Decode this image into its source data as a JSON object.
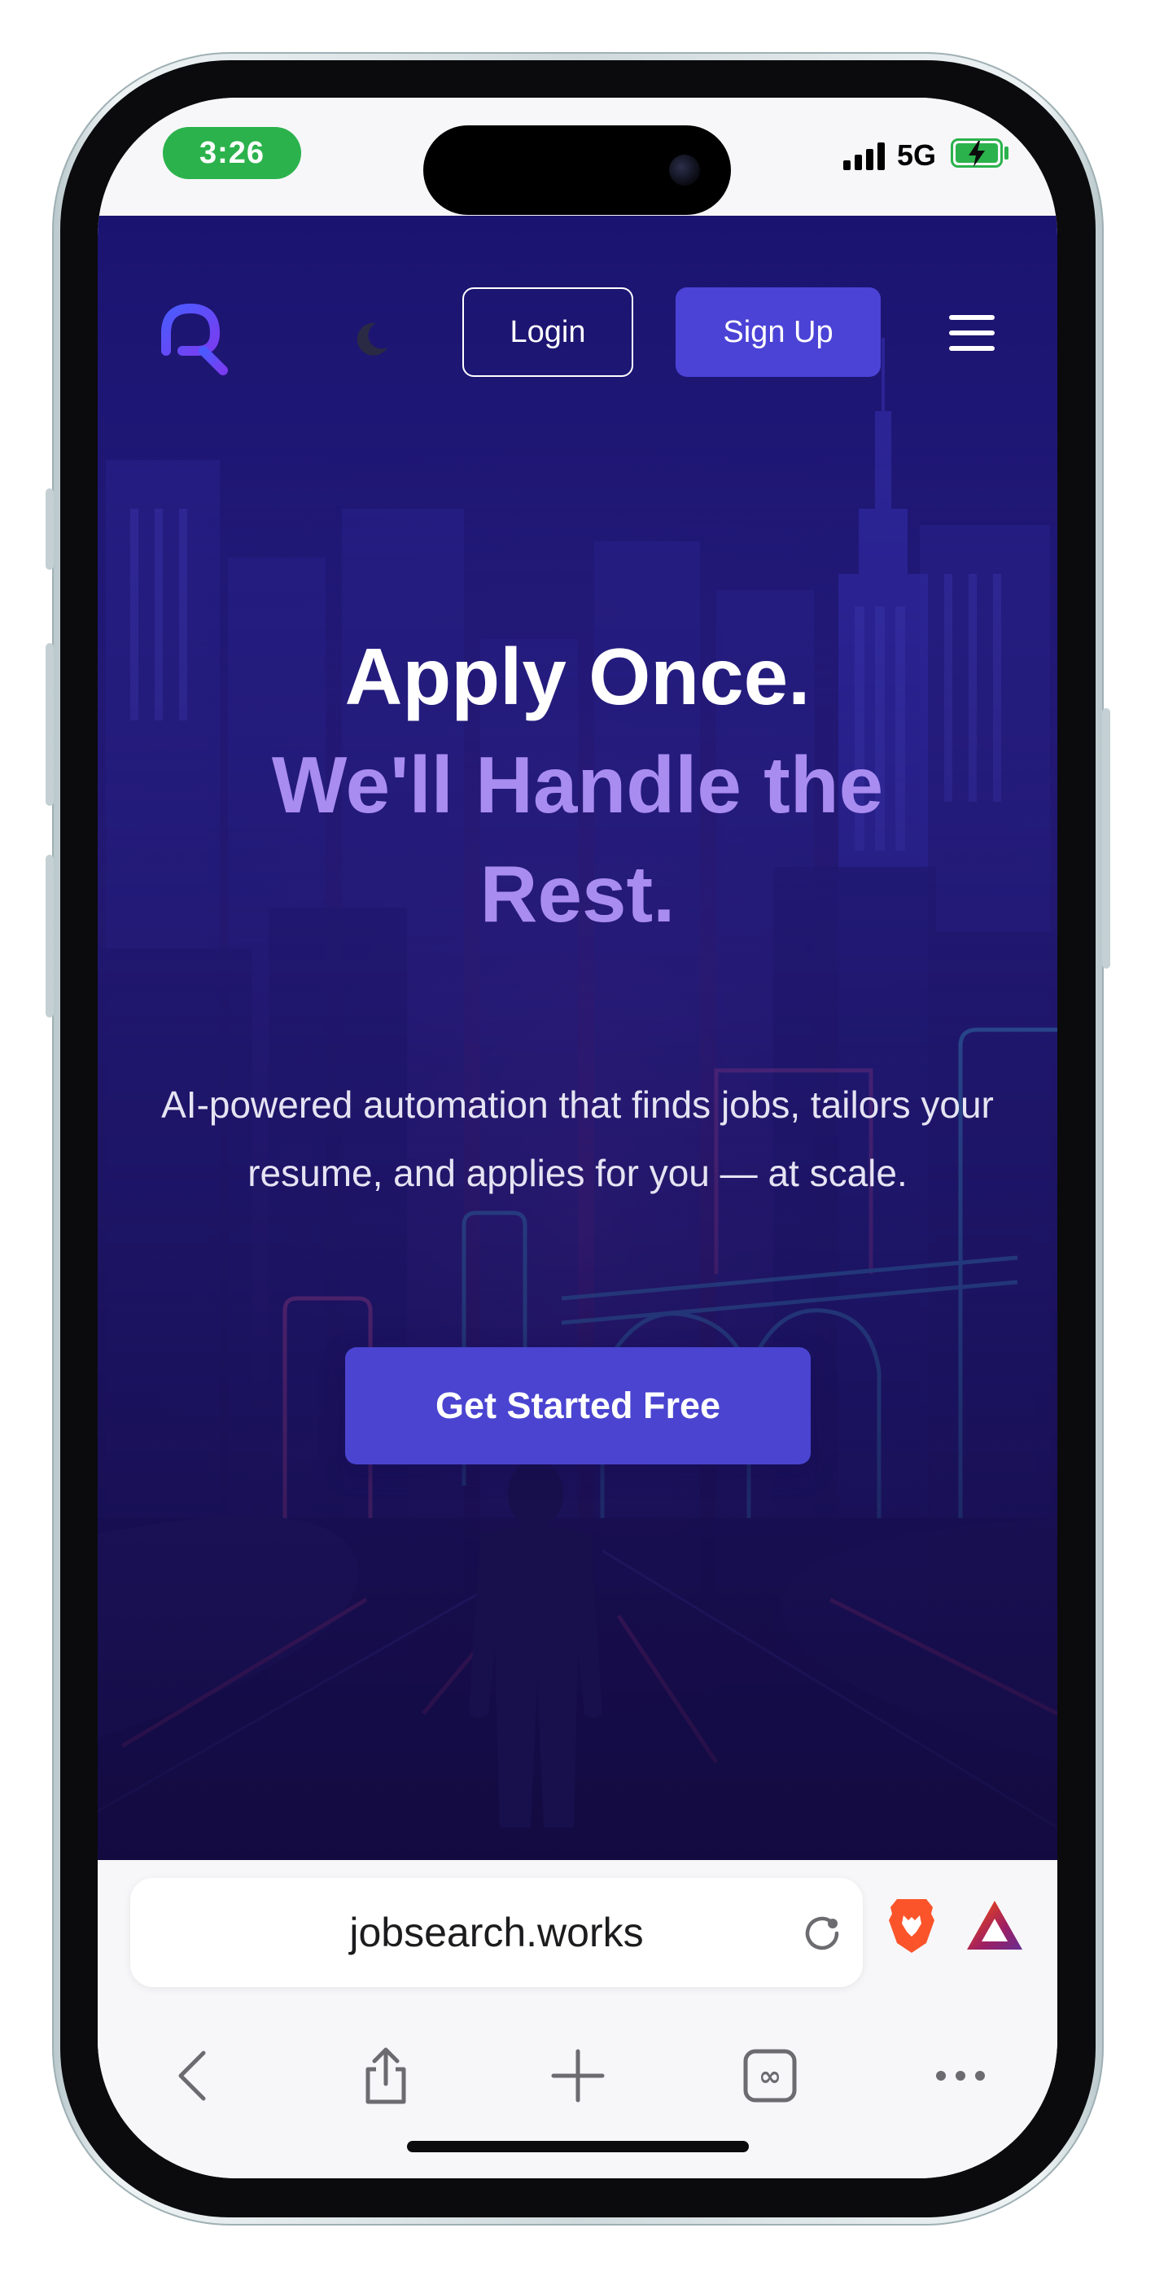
{
  "status_bar": {
    "time": "3:26",
    "network": "5G",
    "time_pill_color": "#2bb24c",
    "battery_state": "charging"
  },
  "site": {
    "nav": {
      "login_label": "Login",
      "signup_label": "Sign Up",
      "logo_icon": "jobsearch-logo-icon",
      "theme_icon": "moon-icon",
      "menu_icon": "hamburger-menu-icon"
    },
    "hero": {
      "title_line1": "Apply Once.",
      "title_line2": "We'll Handle the Rest.",
      "subtitle": "AI-powered automation that finds jobs, tailors your resume, and applies for you — at scale.",
      "cta_label": "Get Started Free"
    },
    "colors": {
      "accent_purple": "#a98cf0",
      "button_indigo": "#4b42d6",
      "background_navy": "#1b1470"
    }
  },
  "browser": {
    "url": "jobsearch.works",
    "toolbar_icons": [
      "reload-icon",
      "brave-lion-icon",
      "bat-rewards-icon"
    ],
    "nav_buttons": [
      "back-icon",
      "share-icon",
      "new-tab-icon",
      "tabs-icon",
      "more-icon"
    ],
    "tab_count_glyph": "∞"
  }
}
